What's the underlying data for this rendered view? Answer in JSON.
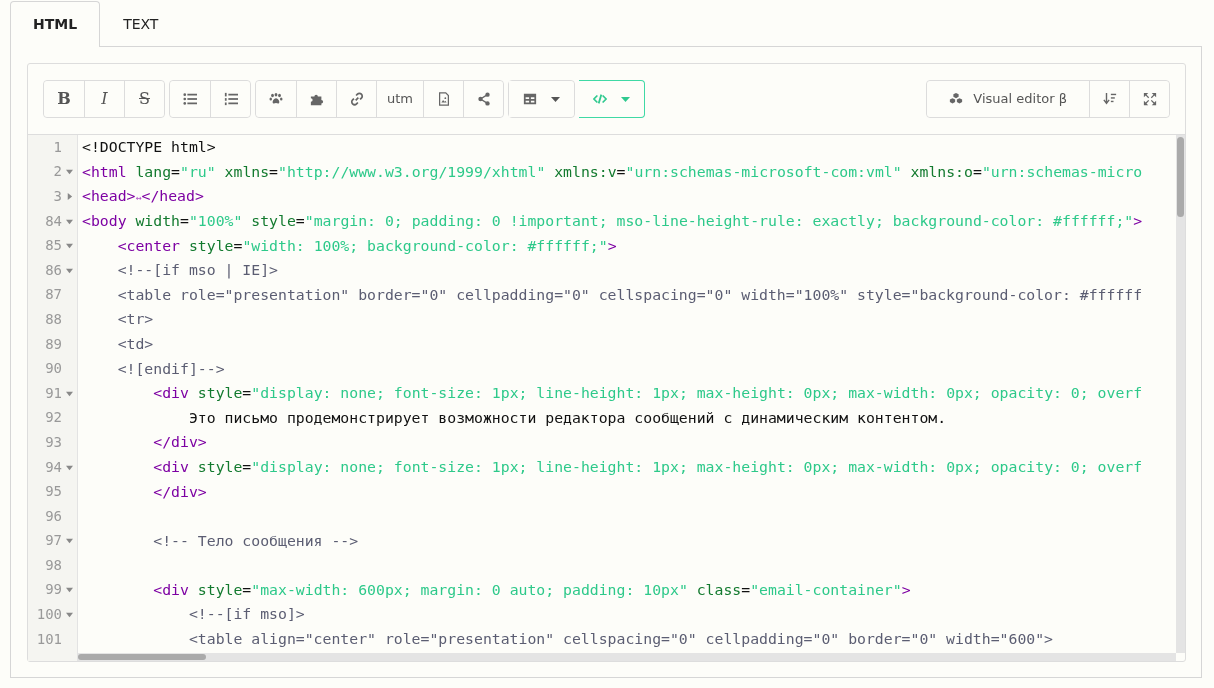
{
  "tabs": [
    {
      "label": "HTML",
      "selected": true
    },
    {
      "label": "TEXT",
      "selected": false
    }
  ],
  "toolbar": {
    "groups": [
      [
        {
          "kind": "bold",
          "label": "B",
          "active": false
        },
        {
          "kind": "italic",
          "label": "I",
          "active": false
        },
        {
          "kind": "strike",
          "label": "S",
          "active": false
        }
      ],
      [
        {
          "kind": "bullet-list",
          "active": false
        },
        {
          "kind": "numbered-list",
          "active": false
        }
      ],
      [
        {
          "kind": "paw",
          "active": false
        },
        {
          "kind": "puzzle",
          "active": false
        },
        {
          "kind": "link",
          "active": false
        },
        {
          "kind": "text",
          "label": "utm",
          "active": false
        },
        {
          "kind": "image-file",
          "active": false
        },
        {
          "kind": "share",
          "active": false
        }
      ],
      [
        {
          "kind": "table-dropdown",
          "active": false
        }
      ],
      [
        {
          "kind": "code-dropdown",
          "active": true
        }
      ]
    ],
    "right": [
      {
        "kind": "visual-editor",
        "label": "Visual editor β"
      },
      {
        "kind": "sort"
      },
      {
        "kind": "fullscreen"
      }
    ]
  },
  "lines": [
    {
      "number": "1",
      "foldable": false,
      "tokens": [
        {
          "kind": "text",
          "text": "<!DOCTYPE html>"
        }
      ]
    },
    {
      "number": "2",
      "foldable": true,
      "expanded": true,
      "tokens": [
        {
          "kind": "tag",
          "text": "<html"
        },
        {
          "kind": "attr",
          "text": " lang"
        },
        {
          "kind": "text",
          "text": "="
        },
        {
          "kind": "value",
          "text": "\"ru\""
        },
        {
          "kind": "attr",
          "text": " xmlns"
        },
        {
          "kind": "text",
          "text": "="
        },
        {
          "kind": "value",
          "text": "\"http://www.w3.org/1999/xhtml\""
        },
        {
          "kind": "attr",
          "text": " xmlns:v"
        },
        {
          "kind": "text",
          "text": "="
        },
        {
          "kind": "value",
          "text": "\"urn:schemas-microsoft-com:vml\""
        },
        {
          "kind": "attr",
          "text": " xmlns:o"
        },
        {
          "kind": "text",
          "text": "="
        },
        {
          "kind": "value",
          "text": "\"urn:schemas-micro"
        }
      ]
    },
    {
      "number": "3",
      "foldable": true,
      "expanded": false,
      "tokens": [
        {
          "kind": "tag",
          "text": "<head>"
        },
        {
          "kind": "marker",
          "text": "↔"
        },
        {
          "kind": "tag",
          "text": "</head>"
        }
      ]
    },
    {
      "number": "84",
      "foldable": true,
      "expanded": true,
      "tokens": [
        {
          "kind": "tag",
          "text": "<body"
        },
        {
          "kind": "attr",
          "text": " width"
        },
        {
          "kind": "text",
          "text": "="
        },
        {
          "kind": "value",
          "text": "\"100%\""
        },
        {
          "kind": "attr",
          "text": " style"
        },
        {
          "kind": "text",
          "text": "="
        },
        {
          "kind": "value",
          "text": "\"margin: 0; padding: 0 !important; mso-line-height-rule: exactly; background-color: #ffffff;\""
        },
        {
          "kind": "tag",
          "text": ">"
        }
      ]
    },
    {
      "number": "85",
      "foldable": true,
      "expanded": true,
      "tokens": [
        {
          "kind": "tag",
          "text": "    <center"
        },
        {
          "kind": "attr",
          "text": " style"
        },
        {
          "kind": "text",
          "text": "="
        },
        {
          "kind": "value",
          "text": "\"width: 100%; background-color: #ffffff;\""
        },
        {
          "kind": "tag",
          "text": ">"
        }
      ]
    },
    {
      "number": "86",
      "foldable": true,
      "expanded": true,
      "tokens": [
        {
          "kind": "comment",
          "text": "    <!--[if mso | IE]>"
        }
      ]
    },
    {
      "number": "87",
      "foldable": false,
      "tokens": [
        {
          "kind": "comment",
          "text": "    <table role=\"presentation\" border=\"0\" cellpadding=\"0\" cellspacing=\"0\" width=\"100%\" style=\"background-color: #ffffff"
        }
      ]
    },
    {
      "number": "88",
      "foldable": false,
      "tokens": [
        {
          "kind": "comment",
          "text": "    <tr>"
        }
      ]
    },
    {
      "number": "89",
      "foldable": false,
      "tokens": [
        {
          "kind": "comment",
          "text": "    <td>"
        }
      ]
    },
    {
      "number": "90",
      "foldable": false,
      "tokens": [
        {
          "kind": "comment",
          "text": "    <![endif]-->"
        }
      ]
    },
    {
      "number": "91",
      "foldable": true,
      "expanded": true,
      "tokens": [
        {
          "kind": "tag",
          "text": "        <div"
        },
        {
          "kind": "attr",
          "text": " style"
        },
        {
          "kind": "text",
          "text": "="
        },
        {
          "kind": "value",
          "text": "\"display: none; font-size: 1px; line-height: 1px; max-height: 0px; max-width: 0px; opacity: 0; overf"
        }
      ]
    },
    {
      "number": "92",
      "foldable": false,
      "tokens": [
        {
          "kind": "text",
          "text": "            Это письмо продемонстрирует возможности редактора сообщений с динамическим контентом."
        }
      ]
    },
    {
      "number": "93",
      "foldable": false,
      "tokens": [
        {
          "kind": "tag",
          "text": "        </div>"
        }
      ]
    },
    {
      "number": "94",
      "foldable": true,
      "expanded": true,
      "tokens": [
        {
          "kind": "tag",
          "text": "        <div"
        },
        {
          "kind": "attr",
          "text": " style"
        },
        {
          "kind": "text",
          "text": "="
        },
        {
          "kind": "value",
          "text": "\"display: none; font-size: 1px; line-height: 1px; max-height: 0px; max-width: 0px; opacity: 0; overf"
        }
      ]
    },
    {
      "number": "95",
      "foldable": false,
      "tokens": [
        {
          "kind": "tag",
          "text": "        </div>"
        }
      ]
    },
    {
      "number": "96",
      "foldable": false
    },
    {
      "number": "97",
      "foldable": true,
      "expanded": true,
      "tokens": [
        {
          "kind": "comment",
          "text": "        <!-- Тело сообщения -->"
        }
      ]
    },
    {
      "number": "98",
      "foldable": false
    },
    {
      "number": "99",
      "foldable": true,
      "expanded": true,
      "tokens": [
        {
          "kind": "tag",
          "text": "        <div"
        },
        {
          "kind": "attr",
          "text": " style"
        },
        {
          "kind": "text",
          "text": "="
        },
        {
          "kind": "value",
          "text": "\"max-width: 600px; margin: 0 auto; padding: 10px\""
        },
        {
          "kind": "attr",
          "text": " class"
        },
        {
          "kind": "text",
          "text": "="
        },
        {
          "kind": "value",
          "text": "\"email-container\""
        },
        {
          "kind": "tag",
          "text": ">"
        }
      ]
    },
    {
      "number": "100",
      "foldable": true,
      "expanded": true,
      "tokens": [
        {
          "kind": "comment",
          "text": "            <!--[if mso]>"
        }
      ]
    },
    {
      "number": "101",
      "foldable": false,
      "tokens": [
        {
          "kind": "comment",
          "text": "            <table align=\"center\" role=\"presentation\" cellspacing=\"0\" cellpadding=\"0\" border=\"0\" width=\"600\">"
        }
      ]
    }
  ]
}
